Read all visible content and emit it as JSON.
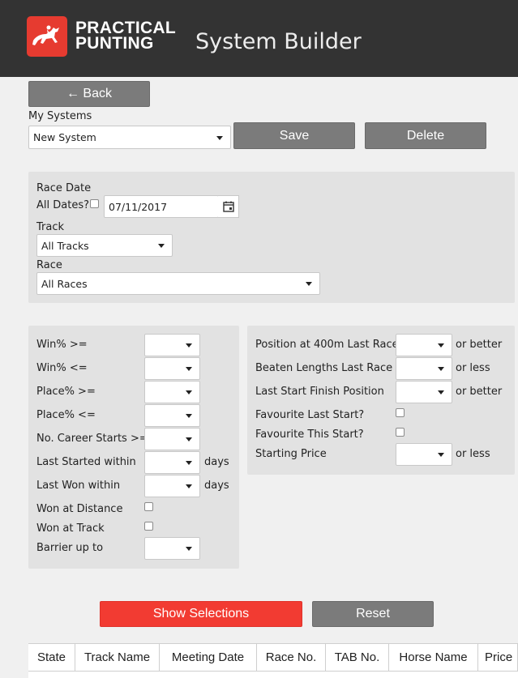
{
  "header": {
    "brand_line1": "PRACTICAL",
    "brand_line2": "PUNTING",
    "title": "System Builder",
    "brand_color": "#e63b30",
    "header_bg": "#333333"
  },
  "nav": {
    "back_label": "←  Back"
  },
  "systems": {
    "label": "My Systems",
    "selected": "New System",
    "save_label": "Save",
    "delete_label": "Delete"
  },
  "race_filters": {
    "race_date_label": "Race Date",
    "all_dates_label": "All Dates?",
    "all_dates_checked": false,
    "date_value": "07/11/2017",
    "track_label": "Track",
    "track_selected": "All Tracks",
    "race_label": "Race",
    "race_selected": "All Races"
  },
  "horse_filters": [
    {
      "label": "Win% >=",
      "value": "",
      "suffix": ""
    },
    {
      "label": "Win% <=",
      "value": "",
      "suffix": ""
    },
    {
      "label": "Place% >=",
      "value": "",
      "suffix": ""
    },
    {
      "label": "Place% <=",
      "value": "",
      "suffix": ""
    },
    {
      "label": "No. Career Starts >=",
      "value": "",
      "suffix": ""
    },
    {
      "label": "Last Started within",
      "value": "",
      "suffix": "days"
    },
    {
      "label": "Last Won within",
      "value": "",
      "suffix": "days"
    }
  ],
  "horse_checks": [
    {
      "label": "Won at Distance",
      "checked": false
    },
    {
      "label": "Won at Track",
      "checked": false
    }
  ],
  "barrier": {
    "label": "Barrier up to",
    "value": ""
  },
  "form_filters": [
    {
      "label": "Position at 400m Last Race",
      "value": "",
      "suffix": "or better"
    },
    {
      "label": "Beaten Lengths Last Race",
      "value": "",
      "suffix": "or less"
    },
    {
      "label": "Last Start Finish Position",
      "value": "",
      "suffix": "or better"
    }
  ],
  "form_checks": [
    {
      "label": "Favourite Last Start?",
      "checked": false
    },
    {
      "label": "Favourite This Start?",
      "checked": false
    }
  ],
  "starting_price": {
    "label": "Starting Price",
    "value": "",
    "suffix": "or less"
  },
  "actions": {
    "show_label": "Show Selections",
    "reset_label": "Reset",
    "accent": "#f23b32"
  },
  "table": {
    "columns": [
      "State",
      "Track Name",
      "Meeting Date",
      "Race No.",
      "TAB No.",
      "Horse Name",
      "Price"
    ]
  }
}
